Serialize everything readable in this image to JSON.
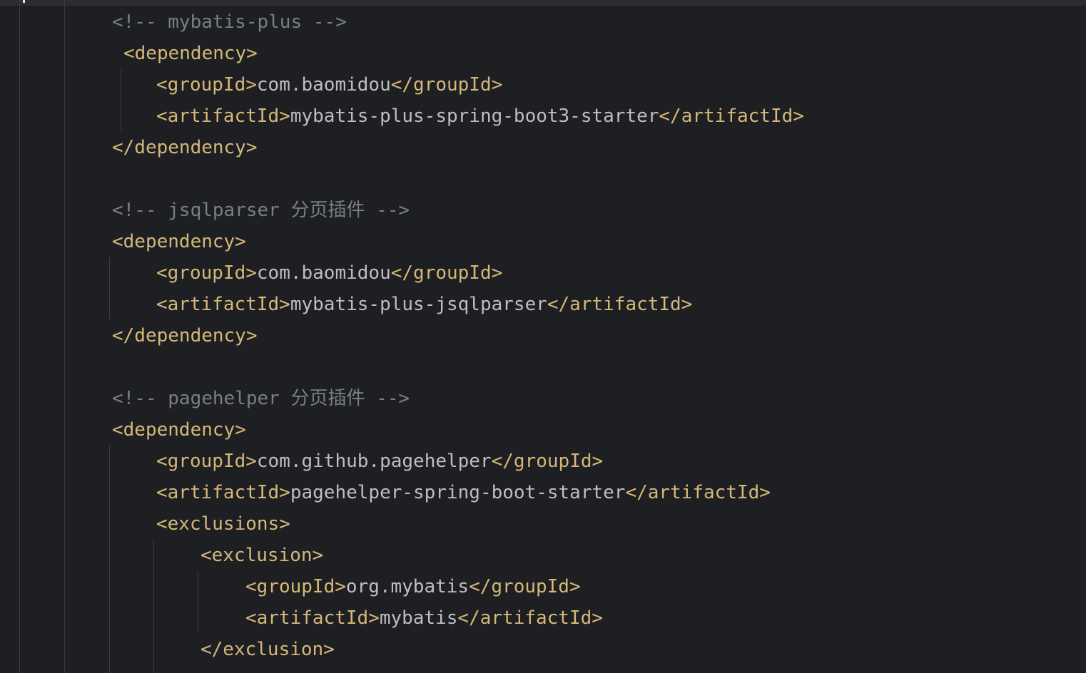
{
  "editor": {
    "lines": [
      {
        "id": "l1",
        "parts": [
          {
            "t": "<!-- mybatis-plus -->",
            "k": "cmt"
          }
        ]
      },
      {
        "id": "l2",
        "parts": [
          {
            "t": "<dependency>",
            "k": "tag"
          }
        ]
      },
      {
        "id": "l3",
        "parts": [
          {
            "t": "<groupId>",
            "k": "tag"
          },
          {
            "t": "com.baomidou",
            "k": "txt"
          },
          {
            "t": "</groupId>",
            "k": "tag"
          }
        ]
      },
      {
        "id": "l4",
        "parts": [
          {
            "t": "<artifactId>",
            "k": "tag"
          },
          {
            "t": "mybatis-plus-spring-boot3-starter",
            "k": "txt"
          },
          {
            "t": "</artifactId>",
            "k": "tag"
          }
        ]
      },
      {
        "id": "l5",
        "parts": [
          {
            "t": "</dependency>",
            "k": "tag"
          }
        ]
      },
      {
        "id": "l6",
        "parts": [
          {
            "t": "<!-- jsqlparser 分页插件 -->",
            "k": "cmt"
          }
        ]
      },
      {
        "id": "l7",
        "parts": [
          {
            "t": "<dependency>",
            "k": "tag"
          }
        ]
      },
      {
        "id": "l8",
        "parts": [
          {
            "t": "<groupId>",
            "k": "tag"
          },
          {
            "t": "com.baomidou",
            "k": "txt"
          },
          {
            "t": "</groupId>",
            "k": "tag"
          }
        ]
      },
      {
        "id": "l9",
        "parts": [
          {
            "t": "<artifactId>",
            "k": "tag"
          },
          {
            "t": "mybatis-plus-jsqlparser",
            "k": "txt"
          },
          {
            "t": "</artifactId>",
            "k": "tag"
          }
        ]
      },
      {
        "id": "l10",
        "parts": [
          {
            "t": "</dependency>",
            "k": "tag"
          }
        ]
      },
      {
        "id": "l11",
        "parts": [
          {
            "t": "<!-- pagehelper 分页插件 -->",
            "k": "cmt"
          }
        ]
      },
      {
        "id": "l12",
        "parts": [
          {
            "t": "<dependency>",
            "k": "tag"
          }
        ]
      },
      {
        "id": "l13",
        "parts": [
          {
            "t": "<groupId>",
            "k": "tag"
          },
          {
            "t": "com.github.pagehelper",
            "k": "txt"
          },
          {
            "t": "</groupId>",
            "k": "tag"
          }
        ]
      },
      {
        "id": "l14",
        "parts": [
          {
            "t": "<artifactId>",
            "k": "tag"
          },
          {
            "t": "pagehelper-spring-boot-starter",
            "k": "txt"
          },
          {
            "t": "</artifactId>",
            "k": "tag"
          }
        ]
      },
      {
        "id": "l15",
        "parts": [
          {
            "t": "<exclusions>",
            "k": "tag"
          }
        ]
      },
      {
        "id": "l16",
        "parts": [
          {
            "t": "<exclusion>",
            "k": "tag"
          }
        ]
      },
      {
        "id": "l17",
        "parts": [
          {
            "t": "<groupId>",
            "k": "tag"
          },
          {
            "t": "org.mybatis",
            "k": "txt"
          },
          {
            "t": "</groupId>",
            "k": "tag"
          }
        ]
      },
      {
        "id": "l18",
        "parts": [
          {
            "t": "<artifactId>",
            "k": "tag"
          },
          {
            "t": "mybatis",
            "k": "txt"
          },
          {
            "t": "</artifactId>",
            "k": "tag"
          }
        ]
      },
      {
        "id": "l19",
        "parts": [
          {
            "t": "</exclusion>",
            "k": "tag"
          }
        ]
      }
    ]
  },
  "theme": {
    "background": "#1e1f22",
    "tag_color": "#d5b778",
    "text_color": "#bcbec4",
    "comment_color": "#7a7e85"
  }
}
